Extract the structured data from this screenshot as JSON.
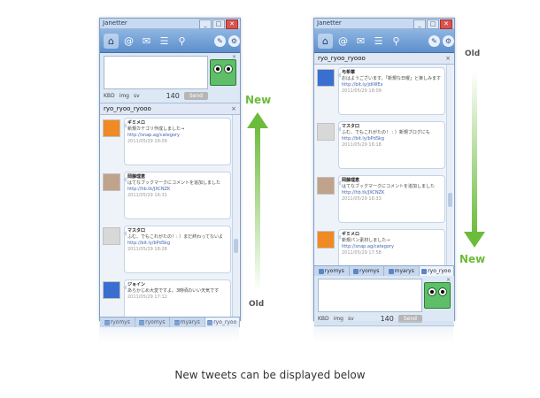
{
  "app": {
    "title": "Janetter",
    "window_controls": [
      "_",
      "□",
      "✕"
    ]
  },
  "toolbar_icons": [
    "home-icon",
    "at-icon",
    "mail-icon",
    "list-icon",
    "search-icon",
    "edit-icon",
    "gear-icon"
  ],
  "compose": {
    "char_count": "140",
    "send_label": "Send",
    "close": "×",
    "tools": [
      "KBD",
      "img",
      "sv"
    ]
  },
  "panel": {
    "title": "ryo_ryoo_ryooo",
    "close": "×"
  },
  "tabs": [
    "ryomys",
    "ryomys",
    "myarys",
    "ryo_ryoo"
  ],
  "tweets": [
    {
      "name": "ギミメロ",
      "text": "新規カテゴリ作成しました→",
      "link": "http://snap.ag/category",
      "meta": "2011/05/29 18:09"
    },
    {
      "name": "岡藤理恵",
      "text": "はてなブックマークにコメントを追加しました",
      "link": "http://hb.tk/JXCNZK",
      "meta": "2011/05/29 16:31"
    },
    {
      "name": "マスタ口",
      "text": "ふむ、でもこれがたの！: ）まだ終わってないよ",
      "link": "http://bit.ly/bPdSkg",
      "meta": "2011/05/29 18:28"
    },
    {
      "name": "ジョイン",
      "text": "あらかじめ大変ですよ。3時頃のいい天気です",
      "link": "",
      "meta": "2011/05/29 17:12"
    }
  ],
  "right_tweets": [
    {
      "name": "与希華",
      "text": "おはようございます。「新規な日曜」と楽しみます",
      "link": "http://bit.ly/jdiWEx",
      "meta": "2011/05/29 18:09"
    },
    {
      "name": "マスタ口",
      "text": "ふむ、でもこれがたの！ : ）新規ブログにも",
      "link": "http://bit.ly/bPdSkg",
      "meta": "2011/05/29 16:18"
    },
    {
      "name": "岡藤理恵",
      "text": "はてなブックマークにコメントを追加しました",
      "link": "http://hb.tk/JXCNZK",
      "meta": "2011/05/29 16:33"
    },
    {
      "name": "ギミメロ",
      "text": "新規パン素材しました→",
      "link": "http://snap.ag/category",
      "meta": "2011/05/29 17:58"
    }
  ],
  "labels": {
    "new": "New",
    "old": "Old"
  },
  "caption": "New tweets can be displayed below",
  "colors": {
    "accent_green": "#6cbc3c",
    "toolbar_blue": "#5d8fcc"
  }
}
